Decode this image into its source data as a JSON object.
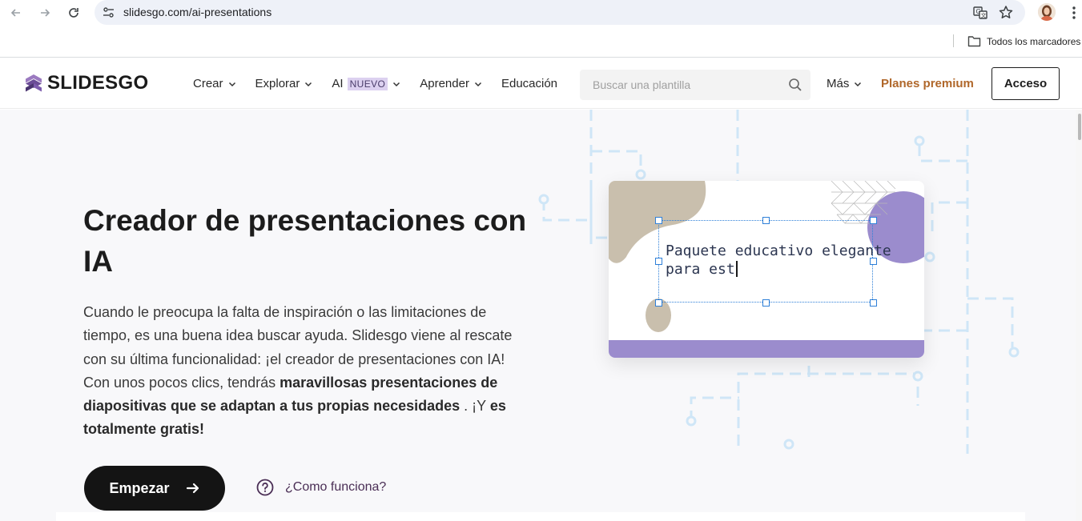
{
  "browser": {
    "url": "slidesgo.com/ai-presentations",
    "bookmarks_label": "Todos los marcadores"
  },
  "header": {
    "logo_text": "SLIDESGO",
    "menu": [
      {
        "label": "Crear",
        "has_dropdown": true
      },
      {
        "label": "Explorar",
        "has_dropdown": true
      },
      {
        "label": "AI",
        "badge": "NUEVO",
        "has_dropdown": true
      },
      {
        "label": "Aprender",
        "has_dropdown": true
      },
      {
        "label": "Educación",
        "has_dropdown": false
      }
    ],
    "search_placeholder": "Buscar una plantilla",
    "more_label": "Más",
    "premium_label": "Planes premium",
    "login_label": "Acceso"
  },
  "hero": {
    "title": "Creador de presentaciones con IA",
    "description_plain": "Cuando le preocupa la falta de inspiración o las limitaciones de tiempo, es una buena idea buscar ayuda. Slidesgo viene al rescate con su última funcionalidad: ¡el creador de presentaciones con IA! Con unos pocos clics, tendrás ",
    "description_bold1": "maravillosas presentaciones de diapositivas que se adaptan a tus propias necesidades",
    "description_mid": " . ¡Y ",
    "description_bold2": "es totalmente gratis!",
    "start_label": "Empezar",
    "how_label": "¿Como funciona?"
  },
  "slide_preview": {
    "typed_line1": "Paquete educativo elegante",
    "typed_line2": "para est"
  },
  "colors": {
    "brand_purple": "#9b8ccd",
    "beige": "#c9bfad",
    "premium": "#b0672a",
    "dark_button": "#141414",
    "circuit_blue": "#cfe6f7"
  }
}
